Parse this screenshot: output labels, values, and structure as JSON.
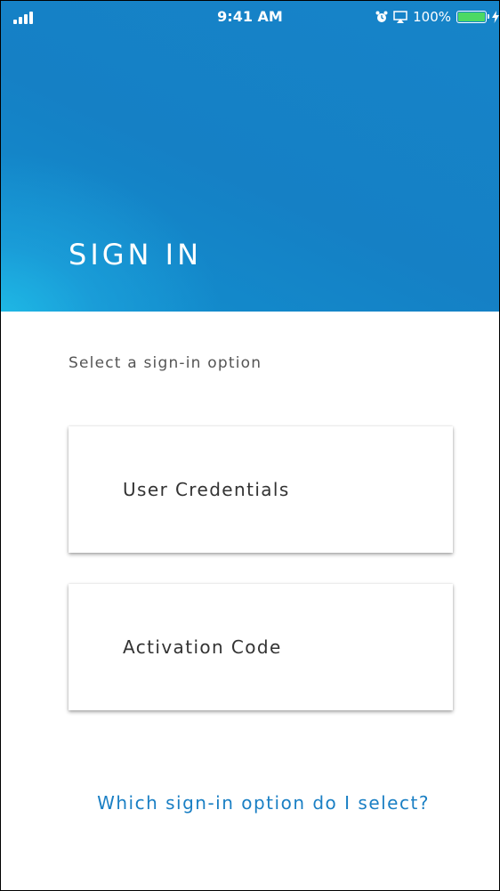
{
  "status_bar": {
    "time": "9:41 AM",
    "battery_percent": "100%",
    "battery_level": 1.0,
    "icons": [
      "signal-icon",
      "alarm-icon",
      "airplay-icon",
      "battery-icon",
      "charging-bolt-icon"
    ],
    "battery_color": "#4cd964"
  },
  "header": {
    "title": "SIGN IN",
    "background_color": "#1582c7",
    "accent_color": "#20bee8"
  },
  "main": {
    "prompt": "Select a sign-in option",
    "options": [
      {
        "label": "User Credentials"
      },
      {
        "label": "Activation Code"
      }
    ],
    "help_link": "Which sign-in option do I select?",
    "link_color": "#1a7fc4"
  }
}
